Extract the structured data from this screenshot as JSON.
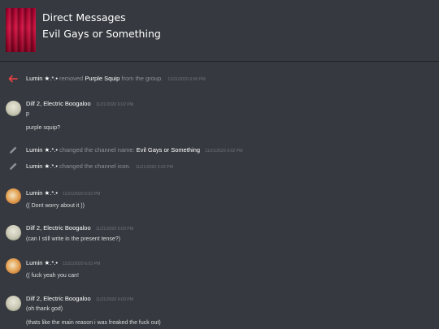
{
  "header": {
    "title": "Direct Messages",
    "subtitle": "Evil Gays or Something"
  },
  "system_messages": [
    {
      "icon": "arrow-left-icon",
      "actor": "Lumin ★.*.•",
      "action": "removed",
      "target": "Purple Squip",
      "rest": "from the group.",
      "timestamp": "11/21/2020 6:00 PM"
    },
    {
      "icon": "pencil-icon",
      "actor": "Lumin ★.*.•",
      "action": "changed the channel name:",
      "target": "Evil Gays or Something",
      "timestamp": "11/21/2020 6:02 PM"
    },
    {
      "icon": "pencil-icon",
      "actor": "Lumin ★.*.•",
      "action": "changed the channel icon.",
      "timestamp": "11/21/2020 6:02 PM"
    }
  ],
  "messages": [
    {
      "author": "Dilf 2, Electric Boogaloo",
      "timestamp": "11/21/2020 6:02 PM",
      "lines": [
        "p",
        "purple squip?"
      ]
    },
    {
      "author": "Lumin ★.*.•",
      "timestamp": "11/21/2020 6:03 PM",
      "lines": [
        "(( Dont worry about it ))"
      ]
    },
    {
      "author": "Dilf 2, Electric Boogaloo",
      "timestamp": "11/21/2020 6:03 PM",
      "lines": [
        "(can I still write in the present tense?)"
      ]
    },
    {
      "author": "Lumin ★.*.•",
      "timestamp": "11/21/2020 6:03 PM",
      "lines": [
        "(( fuck yeah you can!"
      ]
    },
    {
      "author": "Dilf 2, Electric Boogaloo",
      "timestamp": "11/21/2020 6:03 PM",
      "lines": [
        "(oh thank god)",
        "(thats like the main reason i was freaked the fuck out)"
      ]
    }
  ],
  "colors": {
    "background": "#36393f",
    "remove_arrow": "#ed4245",
    "muted": "#8e9297"
  }
}
